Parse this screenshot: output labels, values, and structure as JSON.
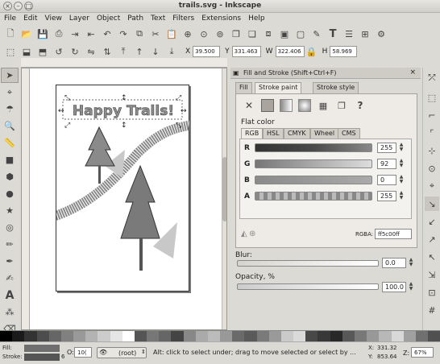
{
  "window": {
    "title": "trails.svg - Inkscape"
  },
  "menu": [
    "File",
    "Edit",
    "View",
    "Layer",
    "Object",
    "Path",
    "Text",
    "Filters",
    "Extensions",
    "Help"
  ],
  "toolbar_controls": {
    "x_label": "X",
    "x_value": "39.500",
    "y_label": "Y",
    "y_value": "331.463",
    "w_label": "W",
    "w_value": "322.406",
    "h_label": "H",
    "h_value": "58.969"
  },
  "canvas": {
    "heading": "Happy Trails!"
  },
  "panel": {
    "title": "Fill and Stroke (Shift+Ctrl+F)",
    "tabs": [
      "Fill",
      "Stroke paint",
      "Stroke style"
    ],
    "section": "Flat color",
    "color_tabs": [
      "RGB",
      "HSL",
      "CMYK",
      "Wheel",
      "CMS"
    ],
    "channels": [
      {
        "label": "R",
        "value": "255"
      },
      {
        "label": "G",
        "value": "92"
      },
      {
        "label": "B",
        "value": "0"
      },
      {
        "label": "A",
        "value": "255"
      }
    ],
    "rgba_label": "RGBA:",
    "rgba_value": "ff5c00ff",
    "blur_label": "Blur:",
    "blur_value": "0.0",
    "opacity_label": "Opacity, %",
    "opacity_value": "100.0"
  },
  "status": {
    "fill_label": "Fill:",
    "stroke_label": "Stroke:",
    "stroke_width": "6",
    "opacity_label": "O:",
    "opacity_value": "10(",
    "layer": "(root)",
    "message": "Alt: click to select under; drag to move selected or select by ...",
    "x_label": "X:",
    "x_value": "331.32",
    "y_label": "Y:",
    "y_value": "853.64",
    "zoom_label": "Z:",
    "zoom_value": "67%"
  },
  "colors": {
    "accent": "#ff5c00",
    "selection": "#e8a04d"
  }
}
